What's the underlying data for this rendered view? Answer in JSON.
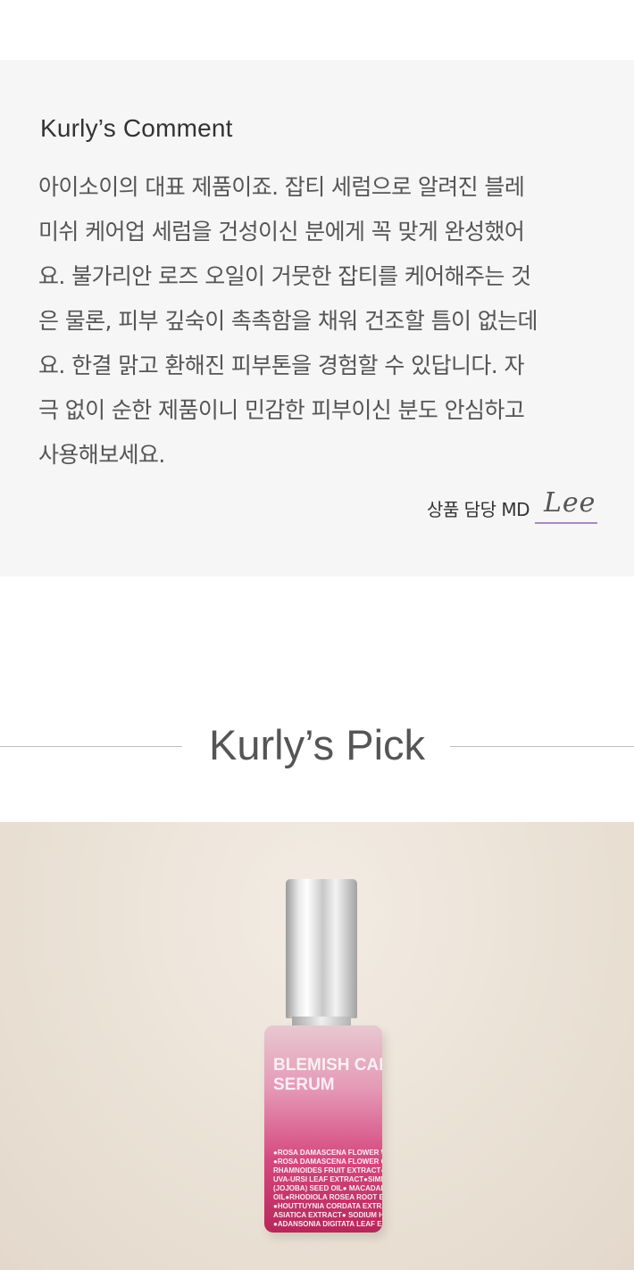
{
  "comment": {
    "title": "Kurly’s Comment",
    "body": "아이소이의 대표 제품이죠. 잡티 세럼으로 알려진 블레\n미쉬 케어업 세럼을 건성이신 분에게 꼭 맞게 완성했어\n요. 불가리안 로즈 오일이 거뭇한 잡티를 케어해주는 것\n은 물론, 피부 깊숙이 촉촉함을 채워 건조할 틈이 없는데\n요. 한결 맑고 환해진 피부톤을 경험할 수 있답니다. 자\n극 없이 순한 제품이니 민감한 피부이신 분도 안심하고\n사용해보세요.",
    "md_label": "상품 담당 MD",
    "md_signature": "Lee",
    "signature_color": "#a989c4",
    "background_color": "#f6f6f6"
  },
  "pick": {
    "title": "Kurly’s Pick"
  },
  "product_image": {
    "label_name": "BLEMISH CARE\nSERUM",
    "label_ingredients": "●ROSA DAMASCENA FLOWER WATER\n●ROSA DAMASCENA FLOWER OIL●\nRHAMNOIDES FRUIT EXTRACT●AR\nUVA-URSI LEAF EXTRACT●SIMMO\n(JOJOBA) SEED OIL● MACADAMIA TE\nOIL●RHODIOLA ROSEA ROOT EXTR\n●HOUTTUYNIA CORDATA EXTRACT\nASIATICA EXTRACT● SODIUM HYAL\n●ADANSONIA DIGITATA LEAF EXTR"
  }
}
